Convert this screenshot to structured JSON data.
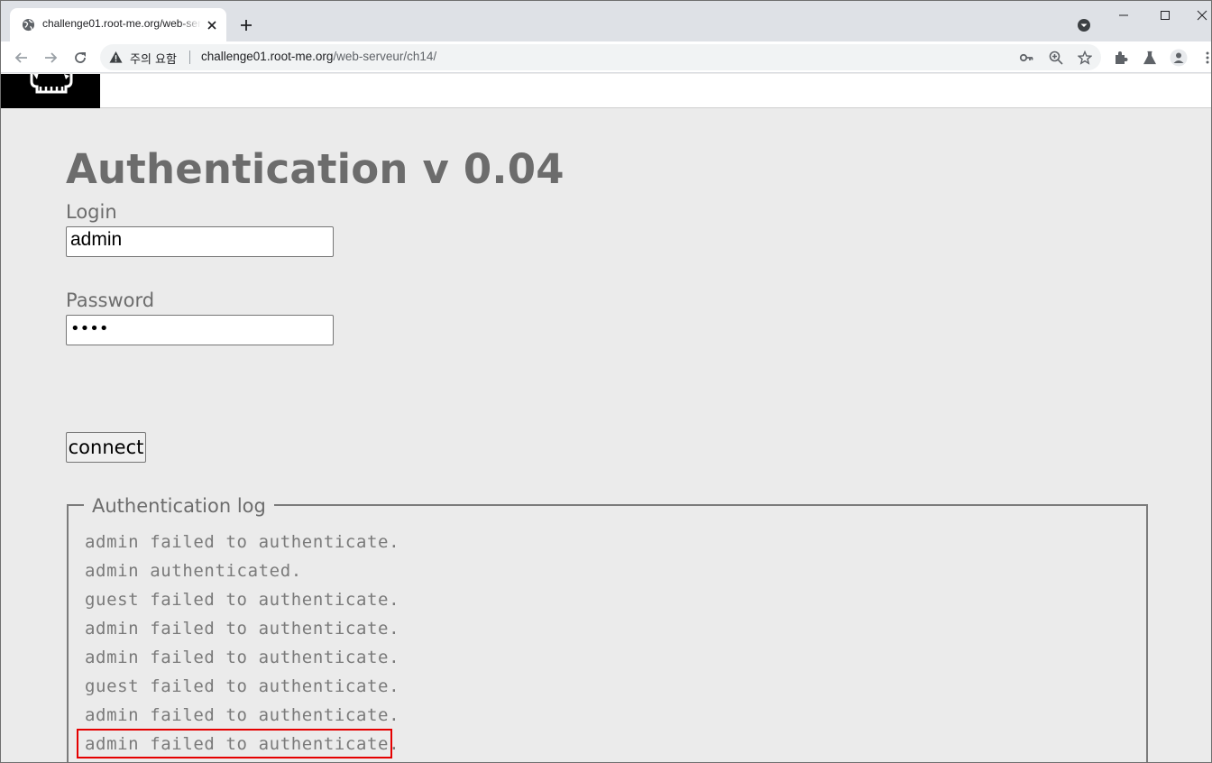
{
  "browser": {
    "tab": {
      "title": "challenge01.root-me.org/web-serveur/ch14/"
    },
    "omnibox": {
      "security_label": "주의 요함",
      "url_host": "challenge01.root-me.org",
      "url_path": "/web-serveur/ch14/"
    },
    "icons": [
      "globe-icon",
      "close-icon",
      "plus-icon",
      "tab-search-icon",
      "minimize-icon",
      "maximize-icon",
      "close-window-icon",
      "back-icon",
      "forward-icon",
      "reload-icon",
      "warning-icon",
      "key-icon",
      "zoom-icon",
      "star-icon",
      "extensions-icon",
      "labs-icon",
      "profile-icon",
      "menu-icon"
    ]
  },
  "page": {
    "title": "Authentication v 0.04",
    "login": {
      "label": "Login",
      "value": "admin"
    },
    "password": {
      "label": "Password",
      "masked_value": "••••"
    },
    "connect_label": "connect",
    "log": {
      "legend": "Authentication log",
      "lines": [
        "admin failed to authenticate.",
        "admin authenticated.",
        "guest failed to authenticate.",
        "admin failed to authenticate.",
        "admin failed to authenticate.",
        "guest failed to authenticate.",
        "admin failed to authenticate.",
        "admin failed to authenticate."
      ]
    }
  },
  "colors": {
    "highlight": "#e50000",
    "text_gray": "#6c6c6c",
    "page_bg": "#ebebeb"
  }
}
